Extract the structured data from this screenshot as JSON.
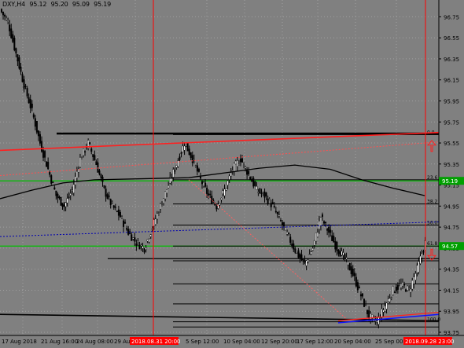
{
  "header": {
    "symbol": "DXY,H4",
    "open": "95.12",
    "high": "95.20",
    "low": "95.09",
    "close": "95.19"
  },
  "colors": {
    "background": "#808080",
    "grid": "#a0a0a0",
    "candle": "#000000",
    "trendline": "#ff2020",
    "green_level": "#00c000",
    "blue_dotted": "#0000b0",
    "ma": "#000000"
  },
  "price_axis": {
    "labels": [
      "96.75",
      "96.55",
      "96.35",
      "96.15",
      "95.95",
      "95.75",
      "95.55",
      "95.35",
      "95.15",
      "94.95",
      "94.75",
      "94.55",
      "94.35",
      "94.15",
      "93.95",
      "93.75"
    ],
    "highlight_green_top": "95.19",
    "highlight_green_bottom": "94.57"
  },
  "time_axis": {
    "labels": [
      "17 Aug 2018",
      "21 Aug 16:00",
      "24 Aug 08:00",
      "29 Aug",
      "5 Sep 12:00",
      "10 Sep 04:00",
      "12 Sep 20:00",
      "17 Sep 12:00",
      "20 Sep 04:00",
      "25 Sep 00:00"
    ],
    "red_labels": [
      "2018.08.31 20:00",
      "2018.09.28 23:00"
    ]
  },
  "fibo_labels": [
    "0.0",
    "23.6",
    "38.2",
    "50.0",
    "61.8",
    "100.0"
  ],
  "chart_data": {
    "type": "line",
    "symbol": "DXY",
    "timeframe": "H4",
    "ylim": [
      93.72,
      96.85
    ],
    "series": [
      {
        "close": [
          96.7,
          96.4,
          96.1,
          95.85,
          95.55,
          95.3,
          95.05,
          94.95,
          95.1,
          95.4,
          95.55,
          95.35,
          95.1,
          94.95,
          94.85,
          94.7,
          94.6,
          94.55,
          94.75,
          94.95,
          95.15,
          95.35,
          95.55,
          95.4,
          95.2,
          95.05,
          94.95,
          95.1,
          95.3,
          95.4,
          95.25,
          95.1,
          95.05,
          94.95,
          94.8,
          94.65,
          94.5,
          94.4,
          94.55,
          94.85,
          94.7,
          94.55,
          94.45,
          94.3,
          94.1,
          93.9,
          93.85,
          94.0,
          94.15,
          94.2,
          94.15,
          94.35,
          94.6,
          94.9,
          95.25
        ]
      }
    ]
  }
}
